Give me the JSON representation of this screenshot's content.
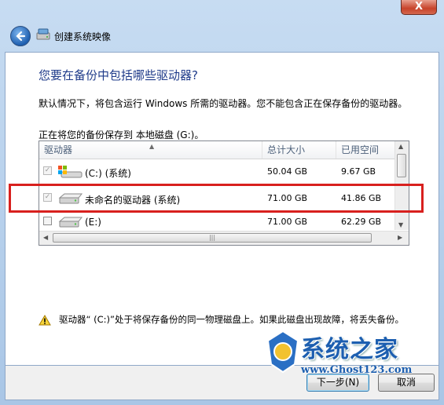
{
  "window": {
    "close_label": "X",
    "title": "创建系统映像"
  },
  "page": {
    "heading": "您要在备份中包括哪些驱动器?",
    "description": "默认情况下，将包含运行 Windows 所需的驱动器。您不能包含正在保存备份的驱动器。",
    "save_location": "正在将您的备份保存到 本地磁盘 (G:)。"
  },
  "table": {
    "columns": [
      "驱动器",
      "总计大小",
      "已用空间"
    ],
    "rows": [
      {
        "checked": true,
        "disabled": true,
        "name": "(C:) (系统)",
        "total": "50.04 GB",
        "used": "9.67 GB",
        "icon": "windows-drive-icon"
      },
      {
        "checked": true,
        "disabled": true,
        "name": "未命名的驱动器 (系统)",
        "total": "71.00 GB",
        "used": "41.86 GB",
        "icon": "hard-drive-icon"
      },
      {
        "checked": false,
        "disabled": false,
        "name": "(E:)",
        "total": "71.00 GB",
        "used": "62.29 GB",
        "icon": "hard-drive-icon"
      }
    ]
  },
  "warning": {
    "text": "驱动器“ (C:)”处于将保存备份的同一物理磁盘上。如果此磁盘出现故障，将丢失备份。"
  },
  "buttons": {
    "next": "下一步(N)",
    "cancel": "取消"
  },
  "watermark": {
    "title": "系统之家",
    "url": "www.Ghost123.com"
  },
  "colors": {
    "heading": "#1f3b8a",
    "highlight": "#d8201e",
    "watermark": "#1d5fb0"
  }
}
